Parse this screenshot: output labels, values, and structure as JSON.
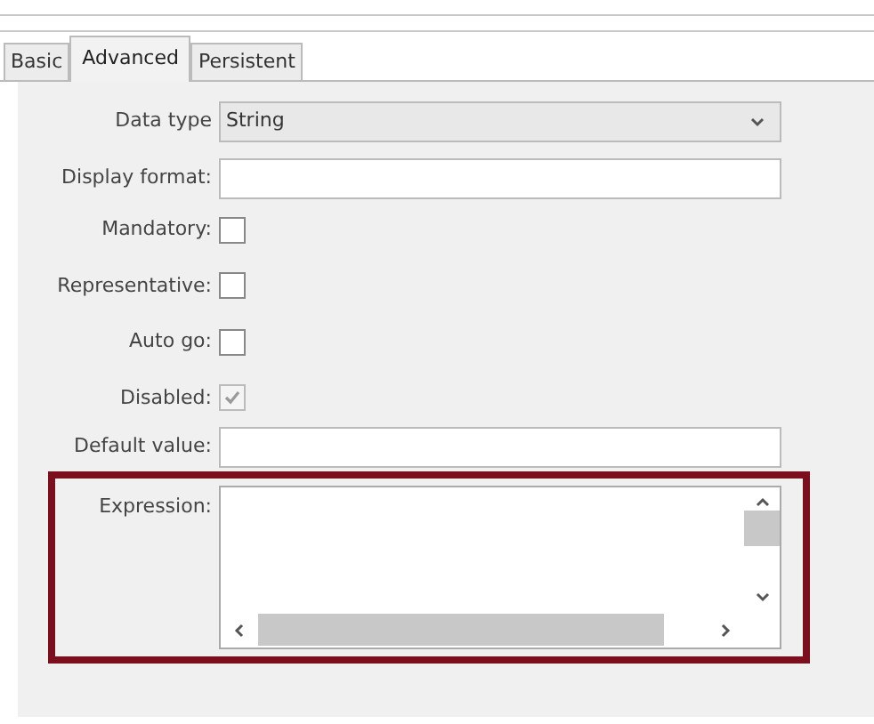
{
  "tabs": [
    {
      "label": "Basic",
      "selected": false
    },
    {
      "label": "Advanced",
      "selected": true
    },
    {
      "label": "Persistent",
      "selected": false
    }
  ],
  "fields": [
    {
      "kind": "select",
      "label": "Data type",
      "value": "String"
    },
    {
      "kind": "text",
      "label": "Display format:"
    },
    {
      "kind": "checkbox",
      "label": "Mandatory:",
      "checked": false,
      "disabled": false
    },
    {
      "kind": "checkbox",
      "label": "Representative:",
      "checked": false,
      "disabled": false
    },
    {
      "kind": "checkbox",
      "label": "Auto go:",
      "checked": false,
      "disabled": false
    },
    {
      "kind": "checkbox",
      "label": "Disabled:",
      "checked": true,
      "disabled": true
    },
    {
      "kind": "text",
      "label": "Default value:"
    },
    {
      "kind": "textarea",
      "label": "Expression:",
      "highlighted": true
    }
  ]
}
